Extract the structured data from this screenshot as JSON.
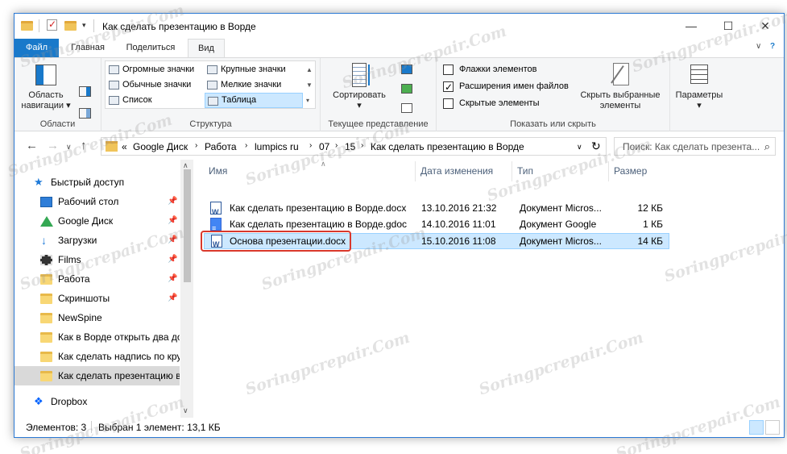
{
  "window": {
    "title": "Как сделать презентацию в Ворде",
    "controls": {
      "minimize": "—",
      "maximize": "☐",
      "close": "✕"
    }
  },
  "ribbon_tabs": [
    {
      "label": "Файл"
    },
    {
      "label": "Главная"
    },
    {
      "label": "Поделиться"
    },
    {
      "label": "Вид",
      "active": true
    }
  ],
  "ribbon": {
    "areas": {
      "label": "Области",
      "nav_pane_label": "Область навигации"
    },
    "structure": {
      "label": "Структура",
      "items": [
        "Огромные значки",
        "Крупные значки",
        "Обычные значки",
        "Мелкие значки",
        "Список",
        "Таблица"
      ],
      "selected": "Таблица"
    },
    "current_view": {
      "label": "Текущее представление",
      "sort_label": "Сортировать"
    },
    "show_hide": {
      "label": "Показать или скрыть",
      "checkboxes": [
        {
          "label": "Флажки элементов",
          "checked": false
        },
        {
          "label": "Расширения имен файлов",
          "checked": true
        },
        {
          "label": "Скрытые элементы",
          "checked": false
        }
      ],
      "hide_selected_label": "Скрыть выбранные элементы"
    },
    "options_label": "Параметры"
  },
  "address": {
    "crumbs": [
      "«",
      "Google Диск",
      "Работа",
      "lumpics ru",
      "07",
      "15",
      "Как сделать презентацию в Ворде"
    ],
    "search_placeholder": "Поиск: Как сделать презента..."
  },
  "nav_pane": {
    "items": [
      {
        "label": "Быстрый доступ",
        "icon": "star-icon",
        "pinned": false
      },
      {
        "label": "Рабочий стол",
        "icon": "desktop-icon",
        "pinned": true
      },
      {
        "label": "Google Диск",
        "icon": "google-drive-icon",
        "pinned": true
      },
      {
        "label": "Загрузки",
        "icon": "download-icon",
        "pinned": true
      },
      {
        "label": "Films",
        "icon": "film-icon",
        "pinned": true
      },
      {
        "label": "Работа",
        "icon": "folder-icon",
        "pinned": true
      },
      {
        "label": "Скриншоты",
        "icon": "folder-icon",
        "pinned": true
      },
      {
        "label": "NewSpine",
        "icon": "folder-icon",
        "pinned": false
      },
      {
        "label": "Как в Ворде открыть два до",
        "icon": "folder-icon",
        "pinned": false
      },
      {
        "label": "Как сделать надпись по кру",
        "icon": "folder-icon",
        "pinned": false
      },
      {
        "label": "Как сделать презентацию в",
        "icon": "folder-icon",
        "pinned": false,
        "selected": true
      },
      {
        "label": "Dropbox",
        "icon": "dropbox-icon",
        "pinned": false
      }
    ]
  },
  "columns": {
    "name": "Имя",
    "modified": "Дата изменения",
    "type": "Тип",
    "size": "Размер"
  },
  "files": [
    {
      "name": "Как сделать презентацию в Ворде.docx",
      "modified": "13.10.2016 21:32",
      "type": "Документ Micros...",
      "size": "12 КБ",
      "icon": "word-doc-icon"
    },
    {
      "name": "Как сделать презентацию в Ворде.gdoc",
      "modified": "14.10.2016 11:01",
      "type": "Документ Google",
      "size": "1 КБ",
      "icon": "google-doc-icon"
    },
    {
      "name": "Основа презентации.docx",
      "modified": "15.10.2016 11:08",
      "type": "Документ Micros...",
      "size": "14 КБ",
      "icon": "word-doc-icon",
      "selected": true
    }
  ],
  "status": {
    "count": "Элементов: 3",
    "selection": "Выбран 1 элемент: 13,1 КБ"
  },
  "watermark": "Soringpcrepair.Com",
  "colors": {
    "accent": "#1979ca",
    "selection": "#cce8ff",
    "highlight_box": "#d9382c"
  }
}
